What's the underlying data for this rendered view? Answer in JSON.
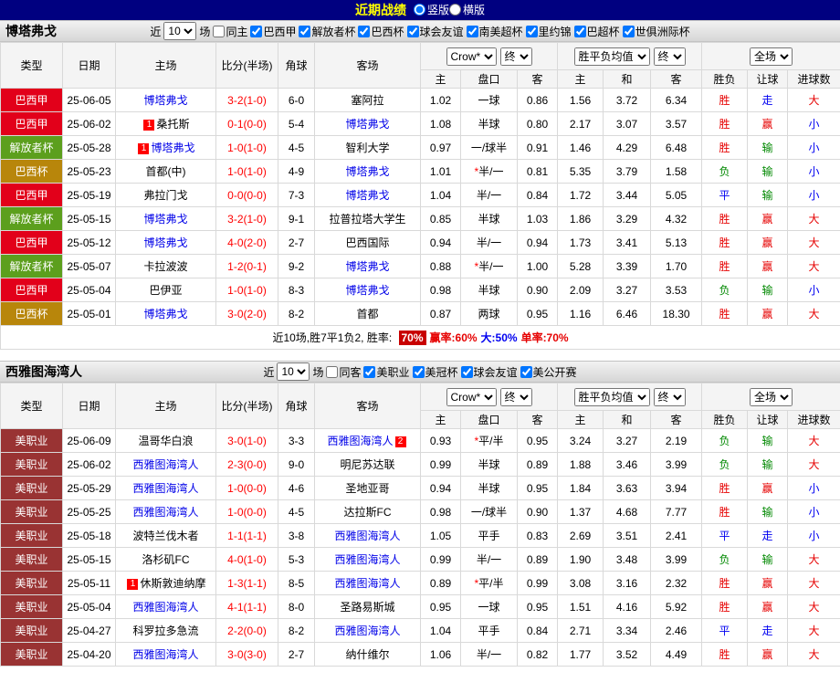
{
  "top_bar": {
    "title": "近期战绩",
    "radios": [
      {
        "label": "竖版",
        "selected": true
      },
      {
        "label": "横版",
        "selected": false
      }
    ]
  },
  "table_header": {
    "type": "类型",
    "date": "日期",
    "home": "主场",
    "score": "比分(半场)",
    "corner": "角球",
    "away": "客场",
    "odds_select": "Crow*",
    "odds_final": "终",
    "eu_select": "胜平负均值",
    "eu_final": "终",
    "scope_select": "全场",
    "sub": {
      "h": "主",
      "hc": "盘口",
      "a": "客",
      "eh": "主",
      "ed": "和",
      "ea": "客",
      "r": "胜负",
      "hr": "让球",
      "gr": "进球数"
    }
  },
  "colors": {
    "topbar_bg": "#000080",
    "title_color": "#ffff00",
    "focus_team": "#0000e8",
    "score": "#ff0000",
    "badge_bg": "#ff0000",
    "star": "#ff0000",
    "summary_highlight_bg": "#c80000",
    "result": {
      "r": "#e60000",
      "b": "#0000f0",
      "g": "#008800"
    }
  },
  "league_colors": {
    "巴西甲": "#e2001a",
    "解放者杯": "#5c9f1d",
    "巴西杯": "#b8860b",
    "美职业": "#993333"
  },
  "sections": [
    {
      "team": "博塔弗戈",
      "filter": {
        "near": "近",
        "count": "10",
        "games": "场",
        "checkboxes": [
          {
            "label": "同主",
            "checked": false
          },
          {
            "label": "巴西甲",
            "checked": true
          },
          {
            "label": "解放者杯",
            "checked": true
          },
          {
            "label": "巴西杯",
            "checked": true
          },
          {
            "label": "球会友谊",
            "checked": true
          },
          {
            "label": "南美超杯",
            "checked": true
          },
          {
            "label": "里约锦",
            "checked": true
          },
          {
            "label": "巴超杯",
            "checked": true
          },
          {
            "label": "世俱洲际杯",
            "checked": true
          }
        ]
      },
      "rows": [
        {
          "lg": "巴西甲",
          "date": "25-06-05",
          "hb": "",
          "home": "博塔弗戈",
          "hblue": true,
          "score": "3-2(1-0)",
          "cor": "6-0",
          "ab": "",
          "away": "塞阿拉",
          "ablue": false,
          "o1": "1.02",
          "star": false,
          "hcap": "一球",
          "o2": "0.86",
          "e1": "1.56",
          "e2": "3.72",
          "e3": "6.34",
          "res": "胜",
          "resc": "r",
          "hres": "走",
          "hresc": "b",
          "gres": "大",
          "gresc": "r"
        },
        {
          "lg": "巴西甲",
          "date": "25-06-02",
          "hb": "1",
          "home": "桑托斯",
          "hblue": false,
          "score": "0-1(0-0)",
          "cor": "5-4",
          "ab": "",
          "away": "博塔弗戈",
          "ablue": true,
          "o1": "1.08",
          "star": false,
          "hcap": "半球",
          "o2": "0.80",
          "e1": "2.17",
          "e2": "3.07",
          "e3": "3.57",
          "res": "胜",
          "resc": "r",
          "hres": "赢",
          "hresc": "r",
          "gres": "小",
          "gresc": "b"
        },
        {
          "lg": "解放者杯",
          "date": "25-05-28",
          "hb": "1",
          "home": "博塔弗戈",
          "hblue": true,
          "score": "1-0(1-0)",
          "cor": "4-5",
          "ab": "",
          "away": "智利大学",
          "ablue": false,
          "o1": "0.97",
          "star": false,
          "hcap": "一/球半",
          "o2": "0.91",
          "e1": "1.46",
          "e2": "4.29",
          "e3": "6.48",
          "res": "胜",
          "resc": "r",
          "hres": "输",
          "hresc": "g",
          "gres": "小",
          "gresc": "b"
        },
        {
          "lg": "巴西杯",
          "date": "25-05-23",
          "hb": "",
          "home": "首都(中)",
          "hblue": false,
          "score": "1-0(1-0)",
          "cor": "4-9",
          "ab": "",
          "away": "博塔弗戈",
          "ablue": true,
          "o1": "1.01",
          "star": true,
          "hcap": "半/一",
          "o2": "0.81",
          "e1": "5.35",
          "e2": "3.79",
          "e3": "1.58",
          "res": "负",
          "resc": "g",
          "hres": "输",
          "hresc": "g",
          "gres": "小",
          "gresc": "b"
        },
        {
          "lg": "巴西甲",
          "date": "25-05-19",
          "hb": "",
          "home": "弗拉门戈",
          "hblue": false,
          "score": "0-0(0-0)",
          "cor": "7-3",
          "ab": "",
          "away": "博塔弗戈",
          "ablue": true,
          "o1": "1.04",
          "star": false,
          "hcap": "半/一",
          "o2": "0.84",
          "e1": "1.72",
          "e2": "3.44",
          "e3": "5.05",
          "res": "平",
          "resc": "b",
          "hres": "输",
          "hresc": "g",
          "gres": "小",
          "gresc": "b"
        },
        {
          "lg": "解放者杯",
          "date": "25-05-15",
          "hb": "",
          "home": "博塔弗戈",
          "hblue": true,
          "score": "3-2(1-0)",
          "cor": "9-1",
          "ab": "",
          "away": "拉普拉塔大学生",
          "ablue": false,
          "o1": "0.85",
          "star": false,
          "hcap": "半球",
          "o2": "1.03",
          "e1": "1.86",
          "e2": "3.29",
          "e3": "4.32",
          "res": "胜",
          "resc": "r",
          "hres": "赢",
          "hresc": "r",
          "gres": "大",
          "gresc": "r"
        },
        {
          "lg": "巴西甲",
          "date": "25-05-12",
          "hb": "",
          "home": "博塔弗戈",
          "hblue": true,
          "score": "4-0(2-0)",
          "cor": "2-7",
          "ab": "",
          "away": "巴西国际",
          "ablue": false,
          "o1": "0.94",
          "star": false,
          "hcap": "半/一",
          "o2": "0.94",
          "e1": "1.73",
          "e2": "3.41",
          "e3": "5.13",
          "res": "胜",
          "resc": "r",
          "hres": "赢",
          "hresc": "r",
          "gres": "大",
          "gresc": "r"
        },
        {
          "lg": "解放者杯",
          "date": "25-05-07",
          "hb": "",
          "home": "卡拉波波",
          "hblue": false,
          "score": "1-2(0-1)",
          "cor": "9-2",
          "ab": "",
          "away": "博塔弗戈",
          "ablue": true,
          "o1": "0.88",
          "star": true,
          "hcap": "半/一",
          "o2": "1.00",
          "e1": "5.28",
          "e2": "3.39",
          "e3": "1.70",
          "res": "胜",
          "resc": "r",
          "hres": "赢",
          "hresc": "r",
          "gres": "大",
          "gresc": "r"
        },
        {
          "lg": "巴西甲",
          "date": "25-05-04",
          "hb": "",
          "home": "巴伊亚",
          "hblue": false,
          "score": "1-0(1-0)",
          "cor": "8-3",
          "ab": "",
          "away": "博塔弗戈",
          "ablue": true,
          "o1": "0.98",
          "star": false,
          "hcap": "半球",
          "o2": "0.90",
          "e1": "2.09",
          "e2": "3.27",
          "e3": "3.53",
          "res": "负",
          "resc": "g",
          "hres": "输",
          "hresc": "g",
          "gres": "小",
          "gresc": "b"
        },
        {
          "lg": "巴西杯",
          "date": "25-05-01",
          "hb": "",
          "home": "博塔弗戈",
          "hblue": true,
          "score": "3-0(2-0)",
          "cor": "8-2",
          "ab": "",
          "away": "首都",
          "ablue": false,
          "o1": "0.87",
          "star": false,
          "hcap": "两球",
          "o2": "0.95",
          "e1": "1.16",
          "e2": "6.46",
          "e3": "18.30",
          "res": "胜",
          "resc": "r",
          "hres": "赢",
          "hresc": "r",
          "gres": "大",
          "gresc": "r"
        }
      ],
      "summary": [
        {
          "text": "近10场,胜7平1负2, 胜率: ",
          "cls": ""
        },
        {
          "text": "70%",
          "cls": "hl"
        },
        {
          "text": "赢率:60%",
          "cls": "red"
        },
        {
          "text": "大:50%",
          "cls": "blue"
        },
        {
          "text": "单率:70%",
          "cls": "red"
        }
      ]
    },
    {
      "team": "西雅图海湾人",
      "filter": {
        "near": "近",
        "count": "10",
        "games": "场",
        "checkboxes": [
          {
            "label": "同客",
            "checked": false
          },
          {
            "label": "美职业",
            "checked": true
          },
          {
            "label": "美冠杯",
            "checked": true
          },
          {
            "label": "球会友谊",
            "checked": true
          },
          {
            "label": "美公开赛",
            "checked": true
          }
        ]
      },
      "rows": [
        {
          "lg": "美职业",
          "date": "25-06-09",
          "hb": "",
          "home": "温哥华白浪",
          "hblue": false,
          "score": "3-0(1-0)",
          "cor": "3-3",
          "ab": "2",
          "away": "西雅图海湾人",
          "ablue": true,
          "o1": "0.93",
          "star": true,
          "hcap": "平/半",
          "o2": "0.95",
          "e1": "3.24",
          "e2": "3.27",
          "e3": "2.19",
          "res": "负",
          "resc": "g",
          "hres": "输",
          "hresc": "g",
          "gres": "大",
          "gresc": "r"
        },
        {
          "lg": "美职业",
          "date": "25-06-02",
          "hb": "",
          "home": "西雅图海湾人",
          "hblue": true,
          "score": "2-3(0-0)",
          "cor": "9-0",
          "ab": "",
          "away": "明尼苏达联",
          "ablue": false,
          "o1": "0.99",
          "star": false,
          "hcap": "半球",
          "o2": "0.89",
          "e1": "1.88",
          "e2": "3.46",
          "e3": "3.99",
          "res": "负",
          "resc": "g",
          "hres": "输",
          "hresc": "g",
          "gres": "大",
          "gresc": "r"
        },
        {
          "lg": "美职业",
          "date": "25-05-29",
          "hb": "",
          "home": "西雅图海湾人",
          "hblue": true,
          "score": "1-0(0-0)",
          "cor": "4-6",
          "ab": "",
          "away": "圣地亚哥",
          "ablue": false,
          "o1": "0.94",
          "star": false,
          "hcap": "半球",
          "o2": "0.95",
          "e1": "1.84",
          "e2": "3.63",
          "e3": "3.94",
          "res": "胜",
          "resc": "r",
          "hres": "赢",
          "hresc": "r",
          "gres": "小",
          "gresc": "b"
        },
        {
          "lg": "美职业",
          "date": "25-05-25",
          "hb": "",
          "home": "西雅图海湾人",
          "hblue": true,
          "score": "1-0(0-0)",
          "cor": "4-5",
          "ab": "",
          "away": "达拉斯FC",
          "ablue": false,
          "o1": "0.98",
          "star": false,
          "hcap": "一/球半",
          "o2": "0.90",
          "e1": "1.37",
          "e2": "4.68",
          "e3": "7.77",
          "res": "胜",
          "resc": "r",
          "hres": "输",
          "hresc": "g",
          "gres": "小",
          "gresc": "b"
        },
        {
          "lg": "美职业",
          "date": "25-05-18",
          "hb": "",
          "home": "波特兰伐木者",
          "hblue": false,
          "score": "1-1(1-1)",
          "cor": "3-8",
          "ab": "",
          "away": "西雅图海湾人",
          "ablue": true,
          "o1": "1.05",
          "star": false,
          "hcap": "平手",
          "o2": "0.83",
          "e1": "2.69",
          "e2": "3.51",
          "e3": "2.41",
          "res": "平",
          "resc": "b",
          "hres": "走",
          "hresc": "b",
          "gres": "小",
          "gresc": "b"
        },
        {
          "lg": "美职业",
          "date": "25-05-15",
          "hb": "",
          "home": "洛杉矶FC",
          "hblue": false,
          "score": "4-0(1-0)",
          "cor": "5-3",
          "ab": "",
          "away": "西雅图海湾人",
          "ablue": true,
          "o1": "0.99",
          "star": false,
          "hcap": "半/一",
          "o2": "0.89",
          "e1": "1.90",
          "e2": "3.48",
          "e3": "3.99",
          "res": "负",
          "resc": "g",
          "hres": "输",
          "hresc": "g",
          "gres": "大",
          "gresc": "r"
        },
        {
          "lg": "美职业",
          "date": "25-05-11",
          "hb": "1",
          "home": "休斯敦迪纳摩",
          "hblue": false,
          "score": "1-3(1-1)",
          "cor": "8-5",
          "ab": "",
          "away": "西雅图海湾人",
          "ablue": true,
          "o1": "0.89",
          "star": true,
          "hcap": "平/半",
          "o2": "0.99",
          "e1": "3.08",
          "e2": "3.16",
          "e3": "2.32",
          "res": "胜",
          "resc": "r",
          "hres": "赢",
          "hresc": "r",
          "gres": "大",
          "gresc": "r"
        },
        {
          "lg": "美职业",
          "date": "25-05-04",
          "hb": "",
          "home": "西雅图海湾人",
          "hblue": true,
          "score": "4-1(1-1)",
          "cor": "8-0",
          "ab": "",
          "away": "圣路易斯城",
          "ablue": false,
          "o1": "0.95",
          "star": false,
          "hcap": "一球",
          "o2": "0.95",
          "e1": "1.51",
          "e2": "4.16",
          "e3": "5.92",
          "res": "胜",
          "resc": "r",
          "hres": "赢",
          "hresc": "r",
          "gres": "大",
          "gresc": "r"
        },
        {
          "lg": "美职业",
          "date": "25-04-27",
          "hb": "",
          "home": "科罗拉多急流",
          "hblue": false,
          "score": "2-2(0-0)",
          "cor": "8-2",
          "ab": "",
          "away": "西雅图海湾人",
          "ablue": true,
          "o1": "1.04",
          "star": false,
          "hcap": "平手",
          "o2": "0.84",
          "e1": "2.71",
          "e2": "3.34",
          "e3": "2.46",
          "res": "平",
          "resc": "b",
          "hres": "走",
          "hresc": "b",
          "gres": "大",
          "gresc": "r"
        },
        {
          "lg": "美职业",
          "date": "25-04-20",
          "hb": "",
          "home": "西雅图海湾人",
          "hblue": true,
          "score": "3-0(3-0)",
          "cor": "2-7",
          "ab": "",
          "away": "纳什维尔",
          "ablue": false,
          "o1": "1.06",
          "star": false,
          "hcap": "半/一",
          "o2": "0.82",
          "e1": "1.77",
          "e2": "3.52",
          "e3": "4.49",
          "res": "胜",
          "resc": "r",
          "hres": "赢",
          "hresc": "r",
          "gres": "大",
          "gresc": "r"
        }
      ],
      "summary": []
    }
  ]
}
